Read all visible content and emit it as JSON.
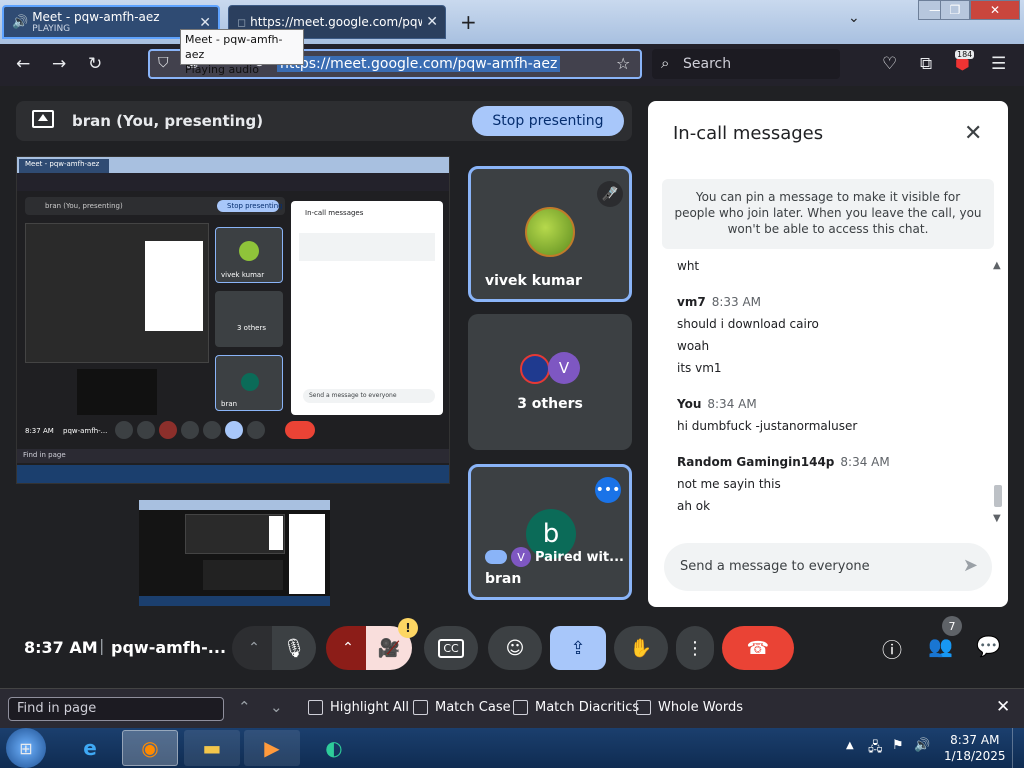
{
  "browser": {
    "tabs": [
      {
        "title": "Meet - pqw-amfh-aez",
        "subtitle": "PLAYING"
      },
      {
        "title": "https://meet.google.com/pqw-amf"
      }
    ],
    "tooltip": {
      "line1": "Meet - pqw-amfh-aez",
      "line2": "Playing audio"
    },
    "url": "https://meet.google.com/pqw-amfh-aez",
    "search_placeholder": "Search",
    "extension_badge": "184"
  },
  "meet": {
    "presenting_label": "bran (You, presenting)",
    "stop_button": "Stop presenting",
    "tiles": {
      "vivek": {
        "name": "vivek kumar"
      },
      "others": {
        "label": "3 others",
        "avatar_letter": "V"
      },
      "bran": {
        "name": "bran",
        "avatar_letter": "b",
        "paired": "Paired wit...",
        "paired_avatar": "V"
      }
    },
    "chat": {
      "title": "In-call messages",
      "notice": "You can pin a message to make it visible for people who join later. When you leave the call, you won't be able to access this chat.",
      "messages": [
        {
          "sender": "",
          "time": "",
          "lines": [
            "wht"
          ]
        },
        {
          "sender": "vm7",
          "time": "8:33 AM",
          "lines": [
            "should i  download cairo",
            "woah",
            "its vm1"
          ]
        },
        {
          "sender": "You",
          "time": "8:34 AM",
          "lines": [
            "hi dumbfuck -justanormaluser"
          ]
        },
        {
          "sender": "Random Gamingin144p",
          "time": "8:34 AM",
          "lines": [
            "not me sayin this",
            "ah ok"
          ]
        }
      ],
      "input_placeholder": "Send a message to everyone"
    },
    "controls": {
      "time": "8:37 AM",
      "separator": "|",
      "meeting_code": "pqw-amfh-...",
      "camera_warning": "!",
      "captions": "CC",
      "people_count": "7"
    },
    "thumbnail": {
      "tab_title": "Meet - pqw-amfh-aez",
      "presenting": "bran (You, presenting)",
      "stop": "Stop presenting",
      "chat_title": "In-call messages",
      "vivek": "vivek kumar",
      "others": "3 others",
      "bran": "bran",
      "time": "8:37 AM",
      "code": "pqw-amfh-...",
      "find": "Find in page",
      "send": "Send a message to everyone"
    }
  },
  "findbar": {
    "placeholder": "Find in page",
    "options": [
      "Highlight All",
      "Match Case",
      "Match Diacritics",
      "Whole Words"
    ]
  },
  "taskbar": {
    "time": "8:37 AM",
    "date": "1/18/2025"
  }
}
